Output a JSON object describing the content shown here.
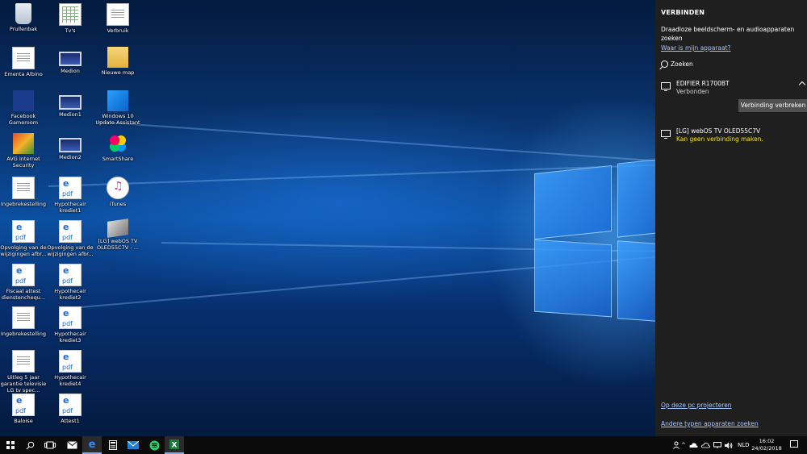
{
  "desktop": {
    "icons": [
      {
        "label": "Prullenbak",
        "icon": "recycle-bin-icon"
      },
      {
        "label": "Tv's",
        "icon": "spreadsheet-icon"
      },
      {
        "label": "Verbruik",
        "icon": "document-icon"
      },
      {
        "label": "Ementa Albino",
        "icon": "document-icon"
      },
      {
        "label": "Medion",
        "icon": "image-icon"
      },
      {
        "label": "Nieuwe map",
        "icon": "folder-icon"
      },
      {
        "label": "Facebook Gameroom",
        "icon": "facebook-gameroom-icon"
      },
      {
        "label": "Medion1",
        "icon": "image-icon"
      },
      {
        "label": "Windows 10 Update Assistant",
        "icon": "windows-logo-icon"
      },
      {
        "label": "AVG Internet Security",
        "icon": "avg-icon"
      },
      {
        "label": "Medion2",
        "icon": "image-icon"
      },
      {
        "label": "SmartShare",
        "icon": "smartshare-icon"
      },
      {
        "label": "Ingebrekestelling",
        "icon": "document-icon"
      },
      {
        "label": "Hypothecair krediet1",
        "icon": "pdf-icon"
      },
      {
        "label": "iTunes",
        "icon": "itunes-icon"
      },
      {
        "label": "Opvolging van de wijzigingen afbr...",
        "icon": "pdf-icon"
      },
      {
        "label": "Opvolging van de wijzigingen afbr...",
        "icon": "pdf-icon"
      },
      {
        "label": "[LG] webOS TV OLED55C7V - ...",
        "icon": "tv-shortcut-icon"
      },
      {
        "label": "Fiscaal attest dienstenchequ...",
        "icon": "pdf-icon"
      },
      {
        "label": "Hypothecair krediet2",
        "icon": "pdf-icon"
      },
      {
        "label": "Ingebrekestelling",
        "icon": "document-icon"
      },
      {
        "label": "Hypothecair krediet3",
        "icon": "pdf-icon"
      },
      {
        "label": "Uitleg 5 jaar garantie televisie LG tv spec...",
        "icon": "document-icon"
      },
      {
        "label": "Hypothecair krediet4",
        "icon": "pdf-icon"
      },
      {
        "label": "Baloise",
        "icon": "pdf-icon"
      },
      {
        "label": "Attest1",
        "icon": "pdf-icon"
      }
    ]
  },
  "connect_panel": {
    "title": "VERBINDEN",
    "subtitle": "Draadloze beeldscherm- en audioapparaten zoeken",
    "help_link": "Waar is mijn apparaat?",
    "search_label": "Zoeken",
    "devices": [
      {
        "name": "EDIFIER R1700BT",
        "status": "Verbonden",
        "icon": "monitor-icon",
        "button": "Verbinding verbreken"
      },
      {
        "name": "[LG] webOS TV OLED55C7V",
        "status": "Kan geen verbinding maken.",
        "icon": "monitor-icon"
      }
    ],
    "project_link": "Op deze pc projecteren",
    "other_link": "Andere typen apparaten zoeken",
    "status_warn_color": "#f4e200",
    "link_color": "#a6c8ff"
  },
  "taskbar": {
    "apps": [
      "start-icon",
      "search-icon",
      "task-view-icon",
      "mail-icon",
      "edge-icon",
      "calculator-icon",
      "outlook-icon",
      "spotify-icon",
      "excel-icon"
    ],
    "language": "NLD",
    "time": "16:02",
    "date": "24/02/2018"
  }
}
